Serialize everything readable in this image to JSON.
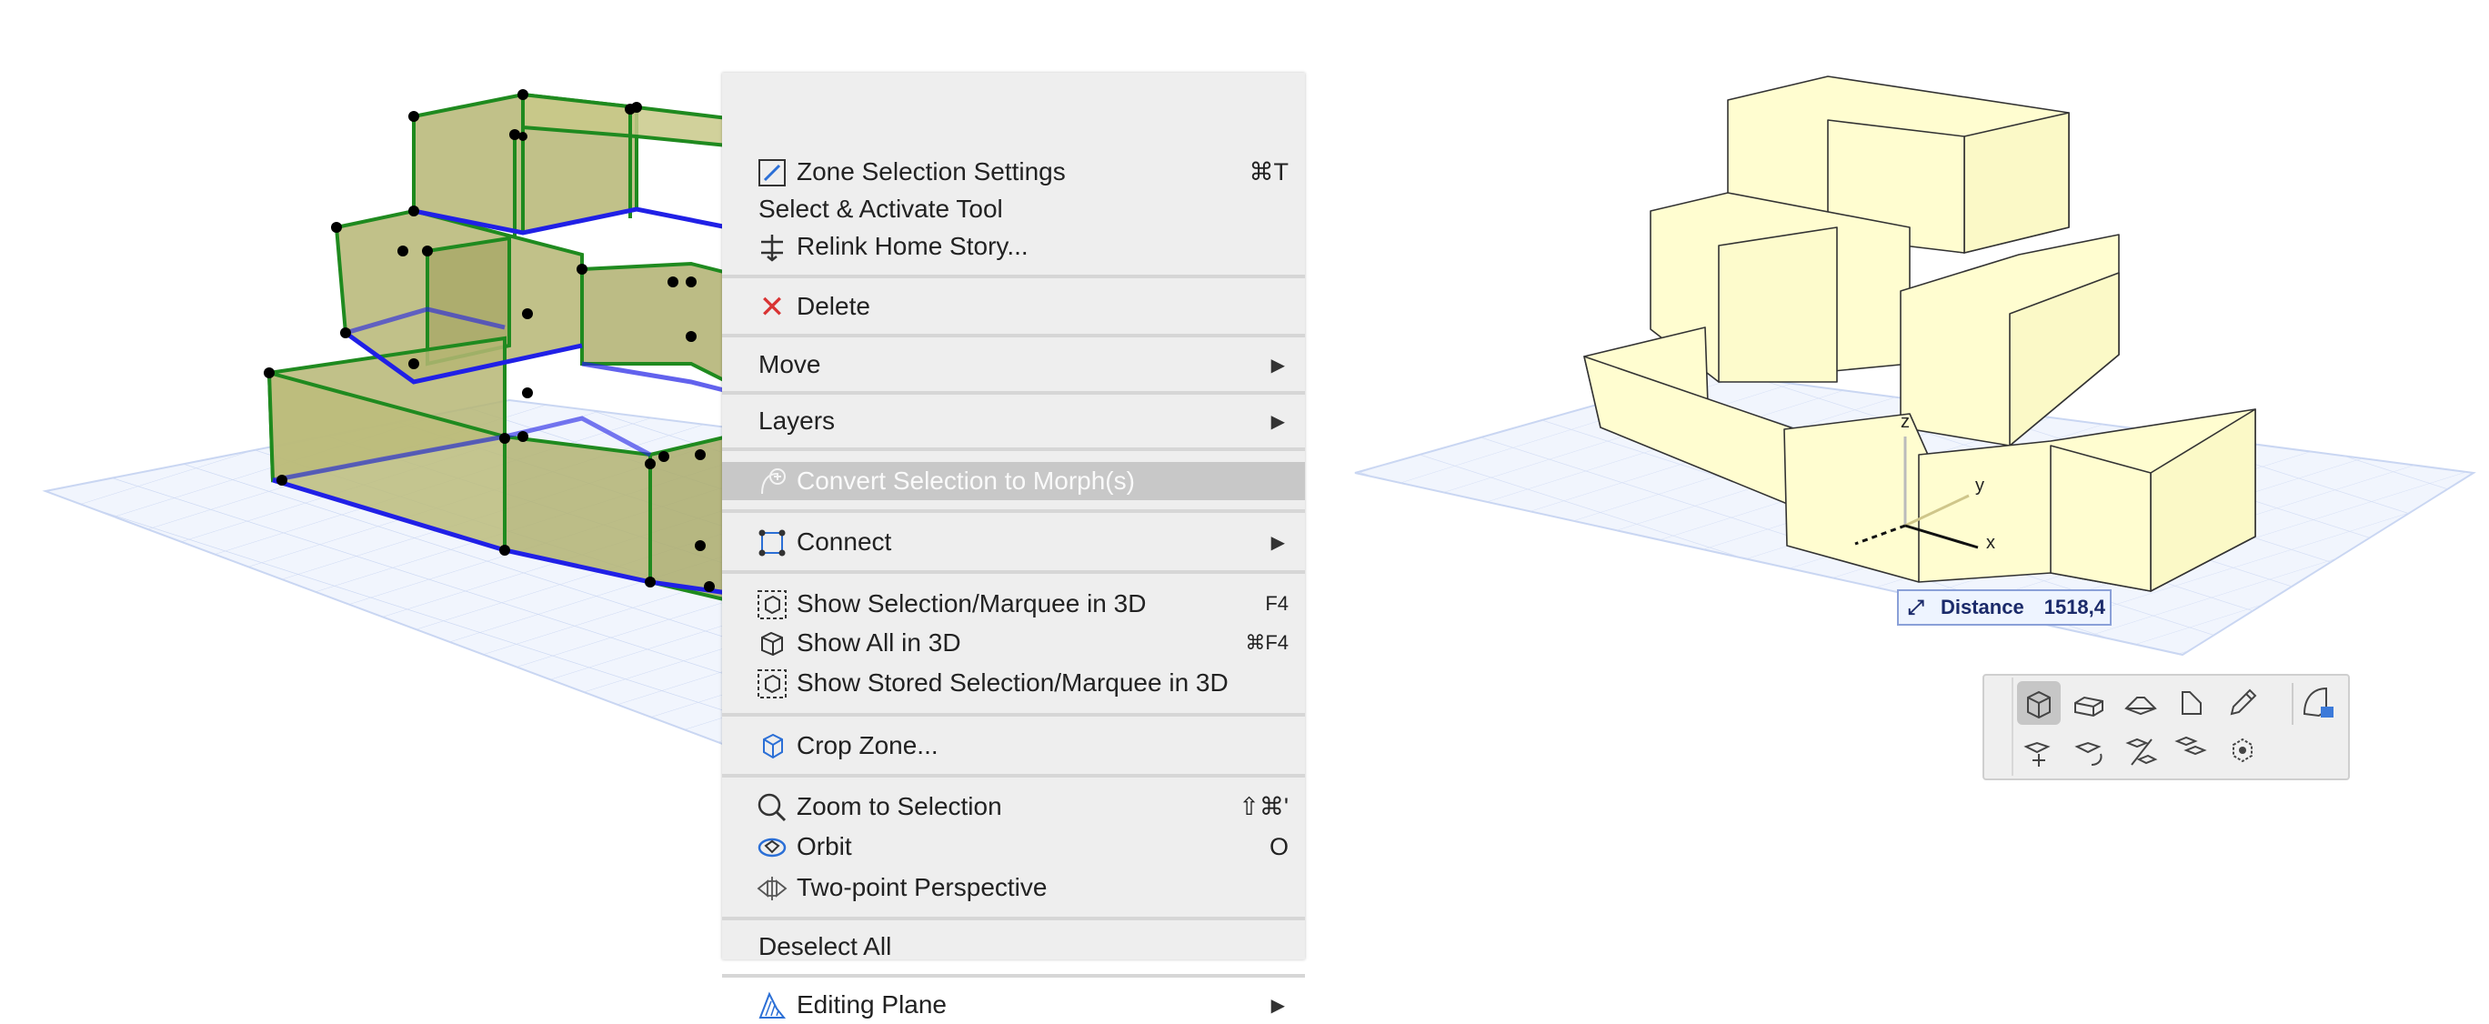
{
  "context_menu": {
    "items": [
      {
        "label": "Zone Selection Settings",
        "shortcut": "⌘T",
        "icon": "zone-settings-icon"
      },
      {
        "label": "Select & Activate Tool",
        "shortcut": "",
        "icon": ""
      },
      {
        "label": "Relink Home Story...",
        "shortcut": "",
        "icon": "relink-story-icon"
      },
      {
        "label": "Delete",
        "shortcut": "",
        "icon": "delete-icon"
      },
      {
        "label": "Move",
        "submenu": true
      },
      {
        "label": "Layers",
        "submenu": true
      },
      {
        "label": "Convert Selection to Morph(s)",
        "highlighted": true,
        "icon": "morph-icon"
      },
      {
        "label": "Connect",
        "submenu": true,
        "icon": "connect-icon"
      },
      {
        "label": "Show Selection/Marquee in 3D",
        "shortcut": "F4",
        "icon": "show-selection-3d-icon"
      },
      {
        "label": "Show All in 3D",
        "shortcut": "⌘F4",
        "icon": "show-all-3d-icon"
      },
      {
        "label": "Show Stored Selection/Marquee in 3D",
        "shortcut": "",
        "icon": "show-stored-3d-icon"
      },
      {
        "label": "Crop Zone...",
        "shortcut": "",
        "icon": "crop-zone-icon"
      },
      {
        "label": "Zoom to Selection",
        "shortcut": "⇧⌘'",
        "icon": "zoom-selection-icon"
      },
      {
        "label": "Orbit",
        "shortcut": "O",
        "icon": "orbit-icon"
      },
      {
        "label": "Two-point Perspective",
        "shortcut": "",
        "icon": "two-point-perspective-icon"
      },
      {
        "label": "Deselect All",
        "shortcut": ""
      },
      {
        "label": "Editing Plane",
        "submenu": true,
        "icon": "editing-plane-icon"
      }
    ],
    "submenu_arrow": "▶"
  },
  "tooltip": {
    "label": "Distance",
    "value": "1518,4",
    "icon": "distance-icon"
  },
  "axes": {
    "x": "x",
    "y": "y",
    "z": "z"
  },
  "palette": {
    "tools": [
      "morph-tool-icon",
      "box-tool-icon",
      "revolve-tool-icon",
      "shape-tool-icon",
      "pencil-tool-icon",
      "morph-settings-icon",
      "move-icon",
      "rotate-icon",
      "mirror-icon",
      "multiply-icon",
      "elevate-icon"
    ]
  },
  "colors": {
    "zone_fill": "#b7b878",
    "zone_edge": "#1f8a1f",
    "zone_base": "#2020e6",
    "morph_fill": "#fffdd0",
    "grid": "#c9d6f2",
    "highlight": "#c8c8c8"
  }
}
